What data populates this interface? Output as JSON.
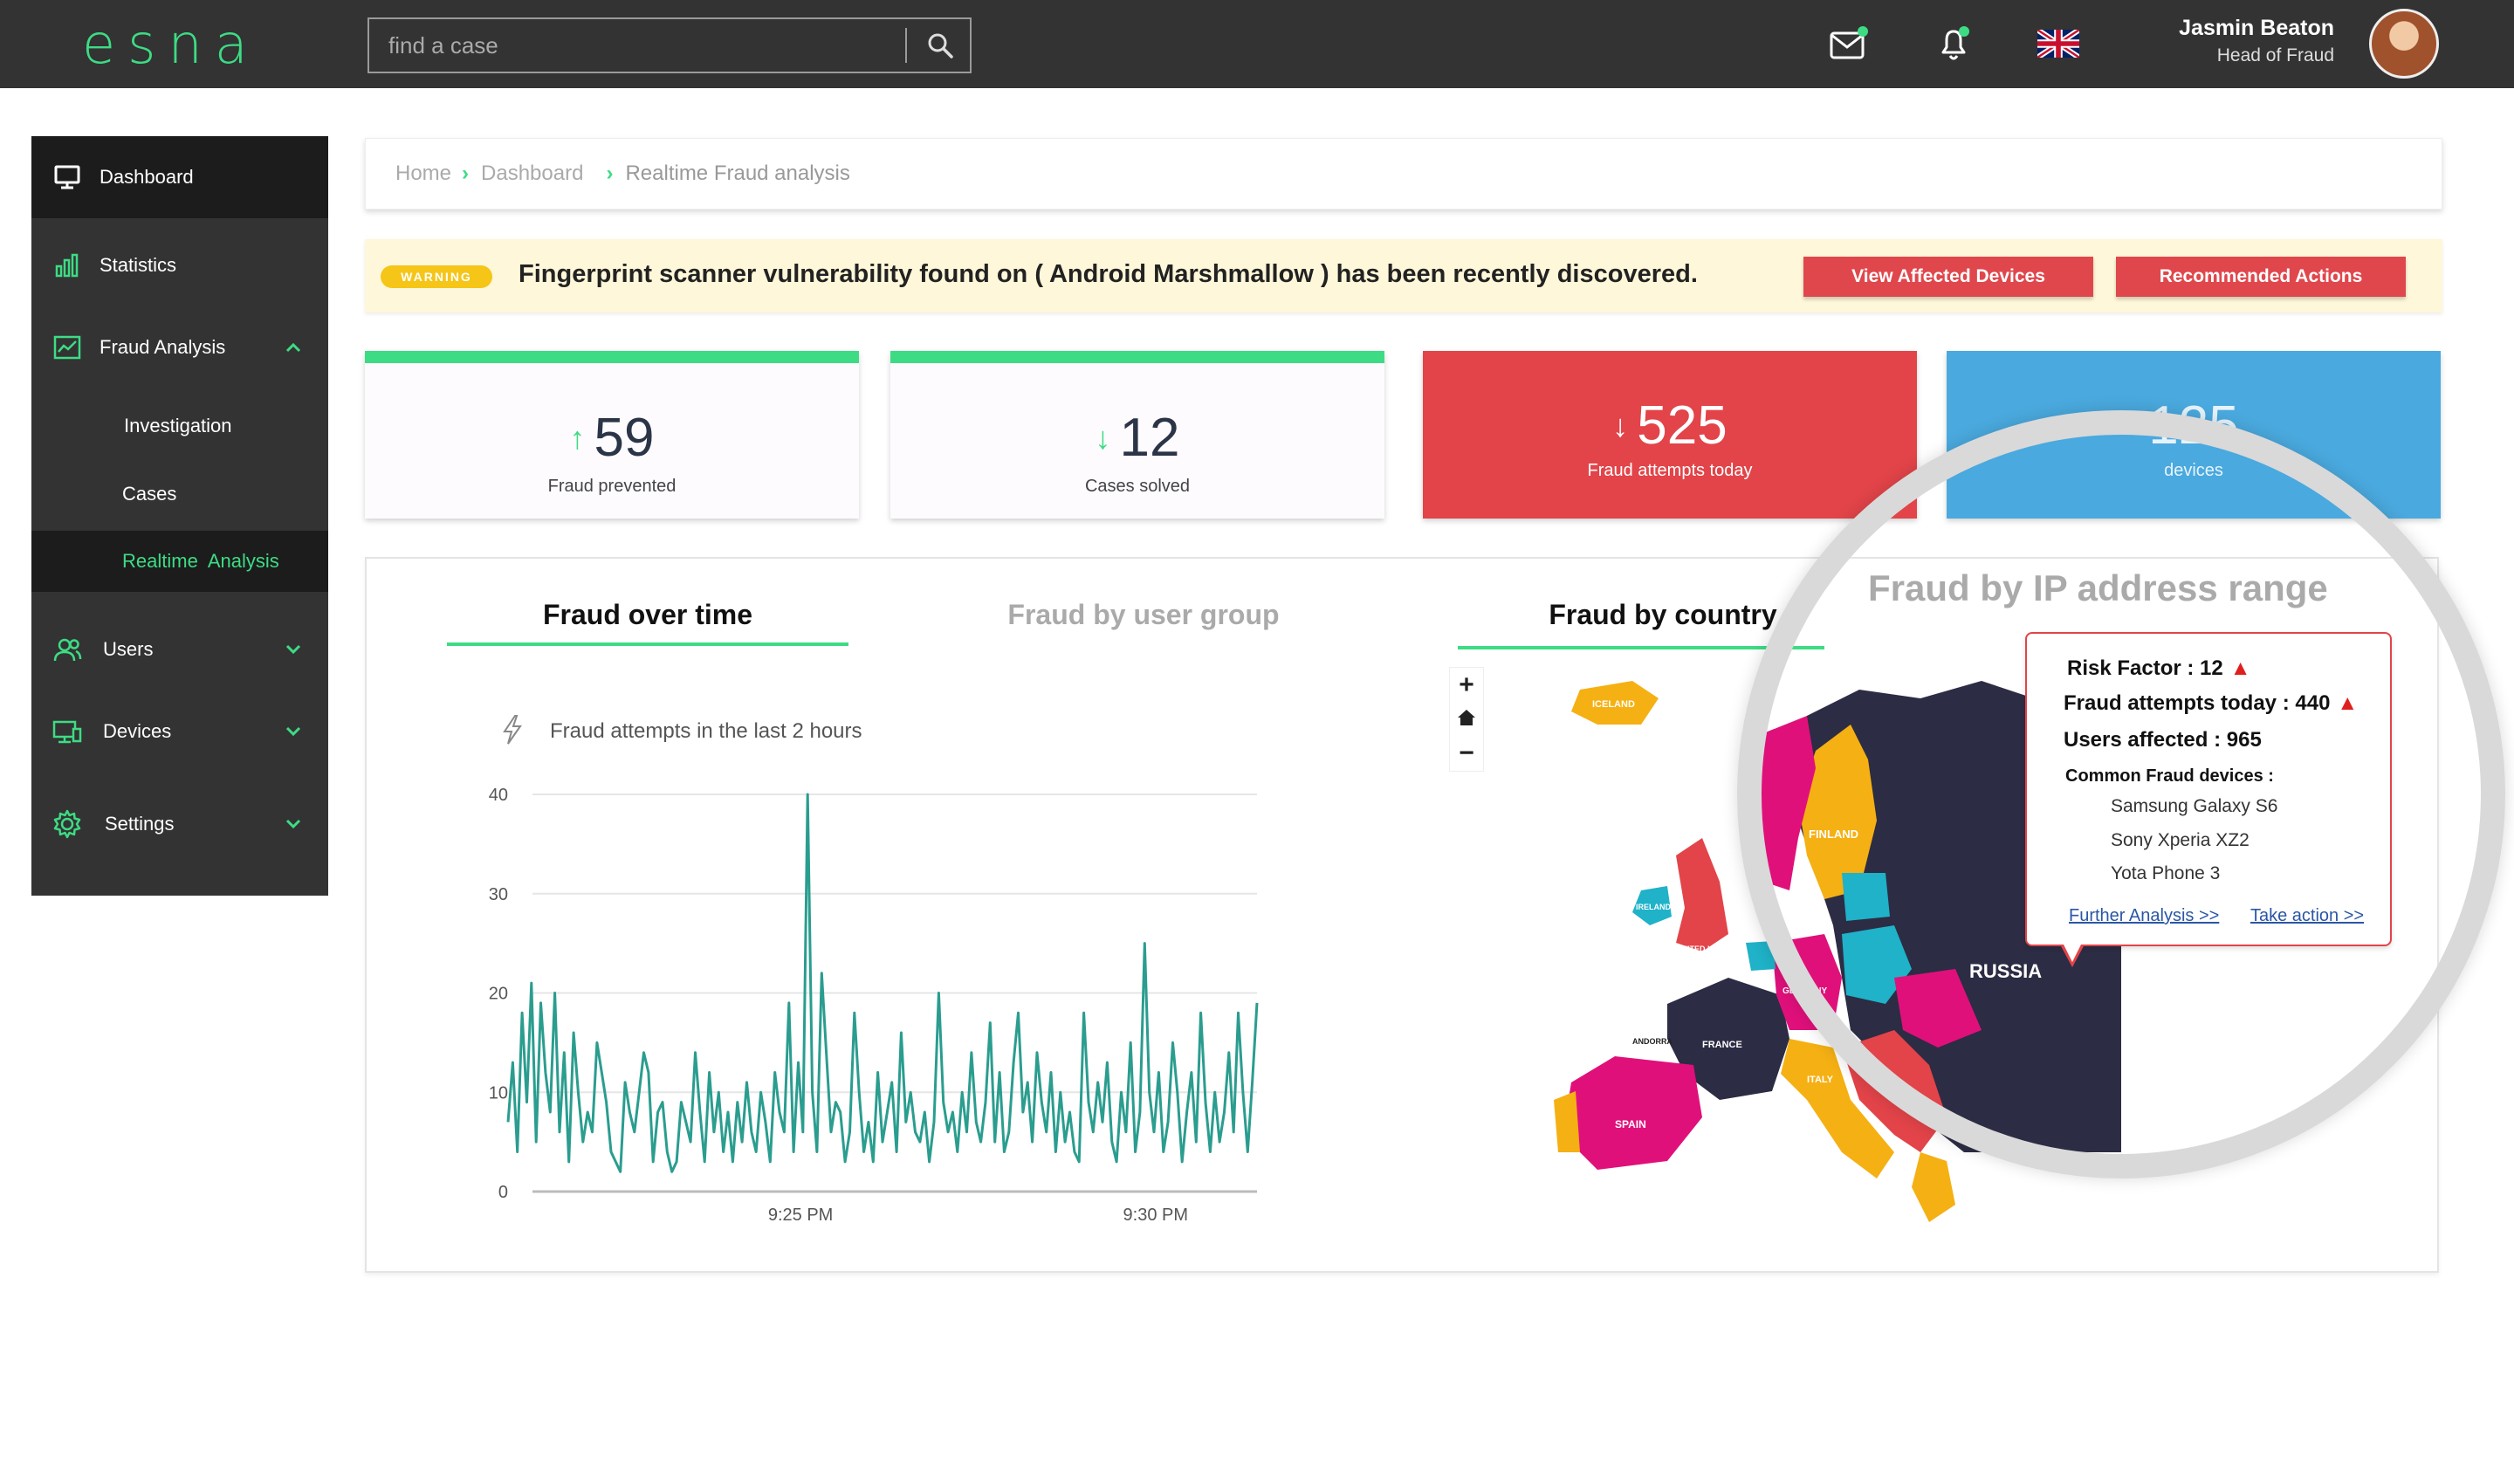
{
  "app": {
    "logo": "esna"
  },
  "search": {
    "placeholder": "find a case"
  },
  "user": {
    "name": "Jasmin Beaton",
    "role": "Head of Fraud"
  },
  "colors": {
    "accent": "#3ddc84",
    "topbar": "#333333",
    "danger": "#e24449",
    "info": "#4aa9de",
    "warning": "#f5c518"
  },
  "sidebar": {
    "items": [
      {
        "label": "Dashboard",
        "icon": "monitor-icon"
      },
      {
        "label": "Statistics",
        "icon": "bar-chart-icon"
      },
      {
        "label": "Fraud Analysis",
        "icon": "chart-window-icon"
      },
      {
        "label": "Investigation"
      },
      {
        "label": "Cases"
      },
      {
        "label": "Realtime  Analysis"
      },
      {
        "label": "Users",
        "icon": "users-icon"
      },
      {
        "label": "Devices",
        "icon": "devices-icon"
      },
      {
        "label": "Settings",
        "icon": "gear-icon"
      }
    ]
  },
  "breadcrumb": {
    "home": "Home",
    "dashboard": "Dashboard",
    "current": "Realtime Fraud analysis"
  },
  "warning": {
    "badge": "WARNING",
    "text": "Fingerprint scanner vulnerability found on ( Android Marshmallow ) has been recently discovered.",
    "btn1": "View Affected Devices",
    "btn2": "Recommended Actions"
  },
  "stats": [
    {
      "value": "59",
      "caption": "Fraud prevented",
      "trend": "up"
    },
    {
      "value": "12",
      "caption": "Cases solved",
      "trend": "down"
    },
    {
      "value": "525",
      "caption": "Fraud attempts today",
      "trend": "down"
    },
    {
      "value": "125",
      "caption": "devices"
    }
  ],
  "tabs": [
    "Fraud over time",
    "Fraud by user group",
    "Fraud by country",
    "Fraud by IP address range"
  ],
  "chart_caption": "Fraud attempts in the last 2 hours",
  "chart_data": {
    "type": "line",
    "title": "",
    "xlabel": "",
    "ylabel": "",
    "ylim": [
      0,
      40
    ],
    "yticks": [
      0,
      10,
      20,
      30,
      40
    ],
    "xticks": [
      "9:25 PM",
      "9:30 PM"
    ],
    "series": [
      {
        "color": "#2a9d8f",
        "values": [
          7,
          13,
          4,
          18,
          9,
          21,
          5,
          19,
          12,
          8,
          20,
          6,
          14,
          3,
          16,
          10,
          5,
          8,
          6,
          15,
          12,
          9,
          4,
          3,
          2,
          11,
          8,
          6,
          10,
          14,
          12,
          3,
          8,
          9,
          4,
          2,
          3,
          9,
          7,
          5,
          14,
          8,
          3,
          12,
          6,
          10,
          4,
          8,
          3,
          9,
          5,
          11,
          6,
          4,
          10,
          7,
          3,
          12,
          8,
          6,
          19,
          4,
          13,
          6,
          40,
          10,
          4,
          22,
          14,
          6,
          9,
          8,
          3,
          6,
          18,
          10,
          4,
          7,
          3,
          12,
          5,
          8,
          11,
          4,
          16,
          7,
          10,
          6,
          5,
          8,
          3,
          7,
          20,
          9,
          6,
          8,
          4,
          10,
          6,
          14,
          7,
          5,
          9,
          17,
          5,
          12,
          4,
          6,
          13,
          18,
          8,
          11,
          5,
          14,
          9,
          6,
          12,
          4,
          10,
          5,
          8,
          4,
          3,
          18,
          9,
          6,
          11,
          7,
          13,
          5,
          3,
          10,
          6,
          15,
          4,
          8,
          25,
          10,
          6,
          12,
          4,
          7,
          15,
          10,
          3,
          8,
          12,
          5,
          18,
          9,
          4,
          10,
          5,
          8,
          14,
          6,
          18,
          10,
          4,
          11,
          19
        ]
      }
    ]
  },
  "map": {
    "labels": [
      "ICELAND",
      "FINLAND",
      "IRELAND",
      "UNITED KINGDOM",
      "LUXEMBOURG",
      "GERMANY",
      "FRANCE",
      "ANDORRA",
      "SPAIN",
      "ITALY",
      "RUSSIA"
    ]
  },
  "tooltip": {
    "risk_label": "Risk Factor :",
    "risk_value": "12",
    "attempts_label": "Fraud attempts today :",
    "attempts_value": "440",
    "users_label": "Users affected :",
    "users_value": "965",
    "devices_label": "Common Fraud devices :",
    "devices": [
      "Samsung Galaxy S6",
      "Sony Xperia XZ2",
      "Yota Phone 3"
    ],
    "link1": "Further Analysis >>",
    "link2": "Take action >>"
  }
}
